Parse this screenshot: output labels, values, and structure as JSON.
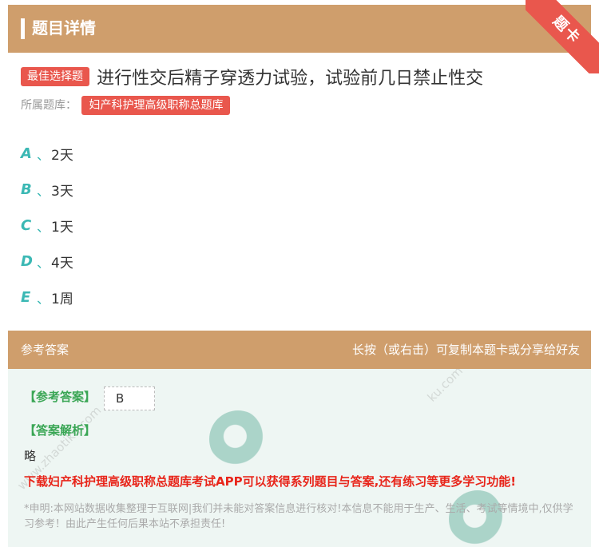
{
  "header": {
    "title": "题目详情",
    "corner_badge": "题卡"
  },
  "question": {
    "type_tag": "最佳选择题",
    "text": "进行性交后精子穿透力试验，试验前几日禁止性交",
    "bank_label": "所属题库：",
    "bank_name": "妇产科护理高级职称总题库"
  },
  "options": [
    {
      "letter": "A",
      "sep": "、",
      "text": "2天"
    },
    {
      "letter": "B",
      "sep": "、",
      "text": "3天"
    },
    {
      "letter": "C",
      "sep": "、",
      "text": "1天"
    },
    {
      "letter": "D",
      "sep": "、",
      "text": "4天"
    },
    {
      "letter": "E",
      "sep": "、",
      "text": "1周"
    }
  ],
  "answer_section": {
    "title": "参考答案",
    "hint": "长按（或右击）可复制本题卡或分享给好友",
    "answer_label": "【参考答案】",
    "answer_value": "B",
    "analysis_label": "【答案解析】",
    "analysis_text": "略",
    "promo": "下载妇产科护理高级职称总题库考试APP可以获得系列题目与答案,还有练习等更多学习功能!",
    "disclaimer": "*申明:本网站数据收集整理于互联网|我们并未能对答案信息进行核对!本信息不能用于生产、生活、考试等情境中,仅供学习参考！由此产生任何后果本站不承担责任!"
  },
  "colors": {
    "header_bg": "#cf9e6c",
    "tag_red": "#e9574d",
    "option_teal": "#3bb8b4",
    "label_green": "#3aa655",
    "promo_red": "#e8251a"
  }
}
